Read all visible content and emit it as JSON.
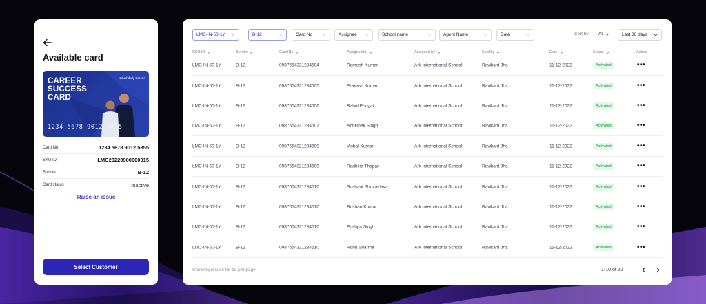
{
  "card_panel": {
    "title": "Available card",
    "card_title_lines": [
      "CAREER",
      "SUCCESS",
      "CARD"
    ],
    "card_logo_text": "Lauchdaily Career",
    "card_number_display": "1234 5678 9012 5855",
    "rows": [
      {
        "label": "Card No.",
        "value": "1234 5678 9012 5855"
      },
      {
        "label": "SKU ID",
        "value": "LMC20220900000015"
      },
      {
        "label": "Bundle",
        "value": "B-12"
      },
      {
        "label": "Card status",
        "value": "Inactive"
      }
    ],
    "raise_issue_label": "Raise an issue",
    "select_button_label": "Select Customer"
  },
  "filters": [
    {
      "label": "LMC-IN-50-1Y",
      "icon": "updown-chevron-icon",
      "active": true
    },
    {
      "label": "B-12",
      "icon": "updown-chevron-icon",
      "active": true
    },
    {
      "label": "Card No",
      "icon": "updown-chevron-icon",
      "active": false
    },
    {
      "label": "Assignee",
      "icon": "updown-chevron-icon",
      "active": false
    },
    {
      "label": "School name",
      "icon": "updown-chevron-icon",
      "active": false
    },
    {
      "label": "Agent Name",
      "icon": "updown-chevron-icon",
      "active": false
    },
    {
      "label": "Date",
      "icon": "updown-chevron-icon",
      "active": false
    }
  ],
  "sort": {
    "label": "Sort by:",
    "value": "All"
  },
  "date_range": "Last 30 days",
  "table": {
    "columns": [
      "SKU ID",
      "Bundle",
      "Card No",
      "Assigned to",
      "Assigned by",
      "Sold by",
      "Date",
      "Status",
      "Action"
    ],
    "rows": [
      {
        "sku": "LMC-IN-50-1Y",
        "bundle": "B-12",
        "card": "0987654321234504",
        "assigned_to": "Ramesh Kumar",
        "assigned_by": "Ark International School",
        "sold_by": "Ravikant Jha",
        "date": "11-12-2022",
        "status": "Activated"
      },
      {
        "sku": "LMC-IN-50-1Y",
        "bundle": "B-12",
        "card": "0987654321234505",
        "assigned_to": "Prakash Kumar",
        "assigned_by": "Ark International School",
        "sold_by": "Ravikant Jha",
        "date": "11-12-2022",
        "status": "Activated"
      },
      {
        "sku": "LMC-IN-50-1Y",
        "bundle": "B-12",
        "card": "0987654321234506",
        "assigned_to": "Rahul Phogat",
        "assigned_by": "Ark International School",
        "sold_by": "Ravikant Jha",
        "date": "11-12-2022",
        "status": "Activated"
      },
      {
        "sku": "LMC-IN-50-1Y",
        "bundle": "B-12",
        "card": "0987654321234507",
        "assigned_to": "Abhishek Singh",
        "assigned_by": "Ark International School",
        "sold_by": "Ravikant Jha",
        "date": "11-12-2022",
        "status": "Activated"
      },
      {
        "sku": "LMC-IN-50-1Y",
        "bundle": "B-12",
        "card": "0987654321234508",
        "assigned_to": "Vishal Kumar",
        "assigned_by": "Ark International School",
        "sold_by": "Ravikant Jha",
        "date": "11-12-2022",
        "status": "Activated"
      },
      {
        "sku": "LMC-IN-50-1Y",
        "bundle": "B-12",
        "card": "0987654321234509",
        "assigned_to": "Radhika Thapar",
        "assigned_by": "Ark International School",
        "sold_by": "Ravikant Jha",
        "date": "11-12-2022",
        "status": "Activated"
      },
      {
        "sku": "LMC-IN-50-1Y",
        "bundle": "B-12",
        "card": "0987654321234510",
        "assigned_to": "Sushant Shrivastava",
        "assigned_by": "Ark International School",
        "sold_by": "Ravikant Jha",
        "date": "11-12-2022",
        "status": "Activated"
      },
      {
        "sku": "LMC-IN-50-1Y",
        "bundle": "B-12",
        "card": "0987654321234510",
        "assigned_to": "Roshan Kumar",
        "assigned_by": "Ark International School",
        "sold_by": "Ravikant Jha",
        "date": "11-12-2022",
        "status": "Activated"
      },
      {
        "sku": "LMC-IN-50-1Y",
        "bundle": "B-12",
        "card": "0987654321234510",
        "assigned_to": "Pushpa Singh",
        "assigned_by": "Ark International School",
        "sold_by": "Ravikant Jha",
        "date": "11-12-2022",
        "status": "Activated"
      },
      {
        "sku": "LMC-IN-50-1Y",
        "bundle": "B-12",
        "card": "0987654321234510",
        "assigned_to": "Rohit Sharma",
        "assigned_by": "Ark International School",
        "sold_by": "Ravikant Jha",
        "date": "11-12-2022",
        "status": "Activated"
      }
    ],
    "action_glyph": "•••"
  },
  "footer": {
    "results_text": "Showing results for 10 per page",
    "pagination": "1-10 of 20"
  },
  "colors": {
    "accent": "#2d24b8",
    "status_bg": "#e3f8e9",
    "status_text": "#1f9d49",
    "background": "#06050c"
  }
}
